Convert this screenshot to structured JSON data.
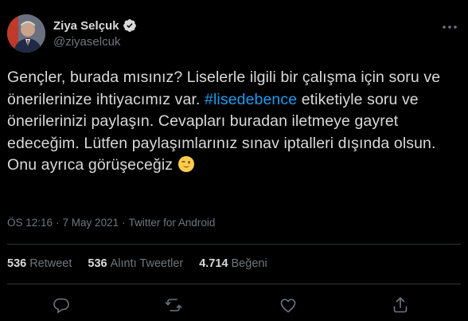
{
  "author": {
    "display_name": "Ziya Selçuk",
    "handle": "@ziyaselcuk",
    "verified": true
  },
  "tweet": {
    "text_before": "Gençler, burada mısınız? Liselerle ilgili bir çalışma için soru ve önerilerinize ihtiyacımız var.",
    "hashtag": "#lisedebence",
    "text_after": "etiketiyle soru ve önerilerinizi paylaşın. Cevapları buradan iletmeye gayret edeceğim. Lütfen paylaşımlarınız sınav iptalleri dışında olsun. Onu ayrıca görüşeceğiz",
    "emoji": "winking-face"
  },
  "meta": {
    "time": "ÖS 12:16",
    "separator": "·",
    "date": "7 May 2021",
    "source": "Twitter for Android"
  },
  "stats": {
    "retweets_count": "536",
    "retweets_label": "Retweet",
    "quotes_count": "536",
    "quotes_label": "Alıntı Tweetler",
    "likes_count": "4.714",
    "likes_label": "Beğeni"
  },
  "colors": {
    "background": "#000000",
    "text": "#d9d9d9",
    "secondary": "#6e767d",
    "accent": "#1d9bf0",
    "divider": "#2f3336"
  },
  "icons": [
    "verified-icon",
    "more-icon",
    "reply-icon",
    "retweet-icon",
    "like-icon",
    "share-icon"
  ]
}
